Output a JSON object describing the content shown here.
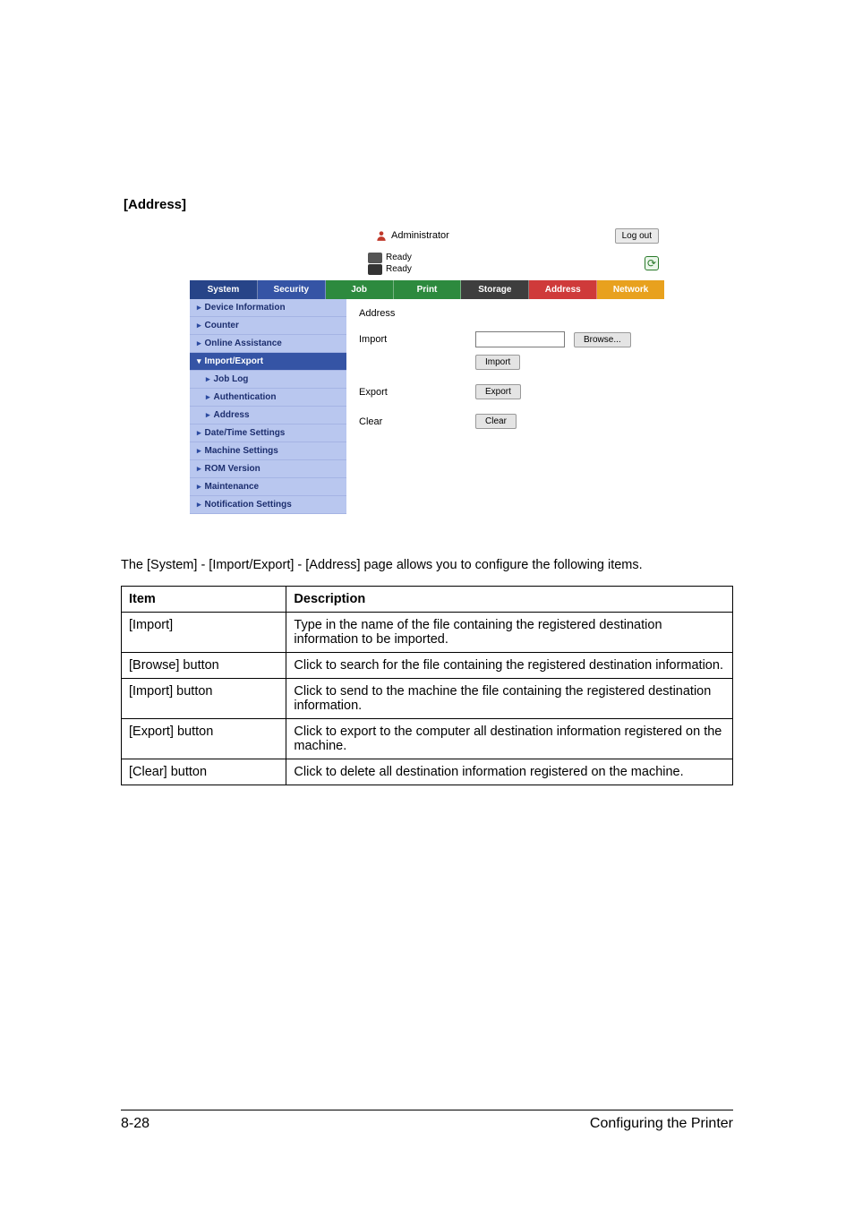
{
  "section_heading": "[Address]",
  "description_paragraph": "The [System] - [Import/Export] - [Address] page allows you to configure the following items.",
  "table": {
    "headers": {
      "item": "Item",
      "description": "Description"
    },
    "rows": [
      {
        "item": "[Import]",
        "description": "Type in the name of the file containing the registered destination information to be imported."
      },
      {
        "item": "[Browse] button",
        "description": "Click to search for the file containing the registered destination information."
      },
      {
        "item": "[Import] button",
        "description": "Click to send to the machine the file containing the registered destination information."
      },
      {
        "item": "[Export] button",
        "description": "Click to export to the computer all destination information registered on the machine."
      },
      {
        "item": "[Clear] button",
        "description": "Click to delete all destination information registered on the machine."
      }
    ]
  },
  "footer": {
    "page_number": "8-28",
    "doc_section": "Configuring the Printer"
  },
  "screenshot": {
    "role": "Administrator",
    "logout": "Log out",
    "status1": "Ready",
    "status2": "Ready",
    "tabs": {
      "system": "System",
      "security": "Security",
      "job": "Job",
      "print": "Print",
      "storage": "Storage",
      "address": "Address",
      "network": "Network"
    },
    "sidebar": {
      "device_info": "Device Information",
      "counter": "Counter",
      "online_assist": "Online Assistance",
      "import_export": "Import/Export",
      "job_log": "Job Log",
      "authentication": "Authentication",
      "address": "Address",
      "date_time": "Date/Time Settings",
      "machine_settings": "Machine Settings",
      "rom_version": "ROM Version",
      "maintenance": "Maintenance",
      "notification": "Notification Settings"
    },
    "content": {
      "heading": "Address",
      "import_label": "Import",
      "browse_btn": "Browse...",
      "import_btn": "Import",
      "export_label": "Export",
      "export_btn": "Export",
      "clear_label": "Clear",
      "clear_btn": "Clear"
    }
  }
}
